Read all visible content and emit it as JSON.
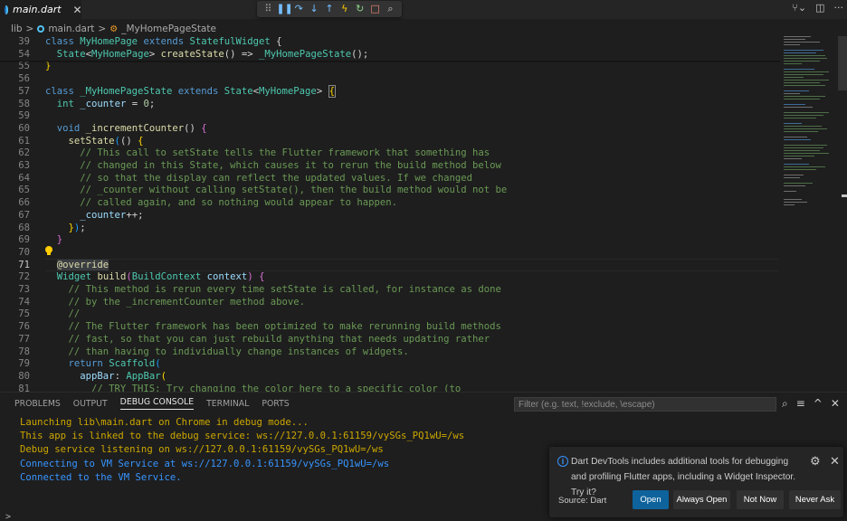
{
  "tab": {
    "title": "main.dart",
    "close_glyph": "✕"
  },
  "debug_toolbar": [
    {
      "name": "drag-handle-icon",
      "glyph": "⠿"
    },
    {
      "name": "pause-icon",
      "glyph": "❚❚"
    },
    {
      "name": "step-over-icon",
      "glyph": "↷"
    },
    {
      "name": "step-into-icon",
      "glyph": "↓"
    },
    {
      "name": "step-out-icon",
      "glyph": "↑"
    },
    {
      "name": "hot-reload-icon",
      "glyph": "ϟ"
    },
    {
      "name": "restart-icon",
      "glyph": "↻"
    },
    {
      "name": "stop-icon",
      "glyph": "□"
    },
    {
      "name": "widget-inspector-icon",
      "glyph": "⌕"
    }
  ],
  "title_actions": {
    "source_control": "⑂⌄",
    "split_editor": "◫",
    "more": "···"
  },
  "breadcrumb": {
    "folder": "lib",
    "file": "main.dart",
    "symbol": "_MyHomePageState",
    "sep": ">"
  },
  "editor": {
    "lines": [
      {
        "n": "39",
        "tokens": [
          [
            "class ",
            "kw"
          ],
          [
            "MyHomePage",
            "cls"
          ],
          [
            " extends ",
            "kw"
          ],
          [
            "StatefulWidget",
            "cls"
          ],
          [
            " {",
            ""
          ]
        ]
      },
      {
        "n": "54",
        "tokens": [
          [
            "  ",
            ""
          ],
          [
            "State",
            "cls"
          ],
          [
            "<",
            ""
          ],
          [
            "MyHomePage",
            "cls"
          ],
          [
            "> ",
            ""
          ],
          [
            "createState",
            "fn"
          ],
          [
            "() => ",
            ""
          ],
          [
            "_MyHomePageState",
            "cls"
          ],
          [
            "();",
            ""
          ]
        ]
      },
      {
        "n": "55",
        "tokens": [
          [
            "}",
            "b1"
          ]
        ]
      },
      {
        "n": "56",
        "tokens": []
      },
      {
        "n": "57",
        "tokens": [
          [
            "class ",
            "kw"
          ],
          [
            "_MyHomePageState",
            "cls"
          ],
          [
            " extends ",
            "kw"
          ],
          [
            "State",
            "cls"
          ],
          [
            "<",
            ""
          ],
          [
            "MyHomePage",
            "cls"
          ],
          [
            "> ",
            ""
          ],
          [
            "{",
            "b1"
          ]
        ]
      },
      {
        "n": "58",
        "tokens": [
          [
            "  ",
            ""
          ],
          [
            "int",
            "cls"
          ],
          [
            " ",
            ""
          ],
          [
            "_counter",
            "var"
          ],
          [
            " = ",
            ""
          ],
          [
            "0",
            "num"
          ],
          [
            ";",
            ""
          ]
        ]
      },
      {
        "n": "59",
        "tokens": []
      },
      {
        "n": "60",
        "tokens": [
          [
            "  ",
            ""
          ],
          [
            "void",
            "kw"
          ],
          [
            " ",
            ""
          ],
          [
            "_incrementCounter",
            "fn"
          ],
          [
            "() ",
            ""
          ],
          [
            "{",
            "b2"
          ]
        ]
      },
      {
        "n": "61",
        "tokens": [
          [
            "    ",
            ""
          ],
          [
            "setState",
            "fn"
          ],
          [
            "(",
            "b3"
          ],
          [
            "() ",
            ""
          ],
          [
            "{",
            "b1"
          ]
        ]
      },
      {
        "n": "62",
        "tokens": [
          [
            "      // This call to setState tells the Flutter framework that something has",
            "cmt"
          ]
        ]
      },
      {
        "n": "63",
        "tokens": [
          [
            "      // changed in this State, which causes it to rerun the build method below",
            "cmt"
          ]
        ]
      },
      {
        "n": "64",
        "tokens": [
          [
            "      // so that the display can reflect the updated values. If we changed",
            "cmt"
          ]
        ]
      },
      {
        "n": "65",
        "tokens": [
          [
            "      // _counter without calling setState(), then the build method would not be",
            "cmt"
          ]
        ]
      },
      {
        "n": "66",
        "tokens": [
          [
            "      // called again, and so nothing would appear to happen.",
            "cmt"
          ]
        ]
      },
      {
        "n": "67",
        "tokens": [
          [
            "      ",
            ""
          ],
          [
            "_counter",
            "var"
          ],
          [
            "++;",
            ""
          ]
        ]
      },
      {
        "n": "68",
        "tokens": [
          [
            "    ",
            ""
          ],
          [
            "}",
            "b1"
          ],
          [
            ")",
            "b3"
          ],
          [
            ";",
            ""
          ]
        ]
      },
      {
        "n": "69",
        "tokens": [
          [
            "  ",
            ""
          ],
          [
            "}",
            "b2"
          ]
        ]
      },
      {
        "n": "70",
        "tokens": []
      },
      {
        "n": "71",
        "tokens": [
          [
            "  ",
            ""
          ],
          [
            "@override",
            "ann"
          ]
        ],
        "active": true
      },
      {
        "n": "72",
        "tokens": [
          [
            "  ",
            ""
          ],
          [
            "Widget",
            "cls"
          ],
          [
            " ",
            ""
          ],
          [
            "build",
            "fn"
          ],
          [
            "(",
            "b2"
          ],
          [
            "BuildContext",
            "cls"
          ],
          [
            " ",
            ""
          ],
          [
            "context",
            "var"
          ],
          [
            ")",
            "b2"
          ],
          [
            " ",
            ""
          ],
          [
            "{",
            "b2"
          ]
        ]
      },
      {
        "n": "73",
        "tokens": [
          [
            "    // This method is rerun every time setState is called, for instance as done",
            "cmt"
          ]
        ]
      },
      {
        "n": "74",
        "tokens": [
          [
            "    // by the _incrementCounter method above.",
            "cmt"
          ]
        ]
      },
      {
        "n": "75",
        "tokens": [
          [
            "    //",
            "cmt"
          ]
        ]
      },
      {
        "n": "76",
        "tokens": [
          [
            "    // The Flutter framework has been optimized to make rerunning build methods",
            "cmt"
          ]
        ]
      },
      {
        "n": "77",
        "tokens": [
          [
            "    // fast, so that you can just rebuild anything that needs updating rather",
            "cmt"
          ]
        ]
      },
      {
        "n": "78",
        "tokens": [
          [
            "    // than having to individually change instances of widgets.",
            "cmt"
          ]
        ]
      },
      {
        "n": "79",
        "tokens": [
          [
            "    ",
            ""
          ],
          [
            "return",
            "kw"
          ],
          [
            " ",
            ""
          ],
          [
            "Scaffold",
            "cls"
          ],
          [
            "(",
            "b3"
          ]
        ]
      },
      {
        "n": "80",
        "tokens": [
          [
            "      ",
            ""
          ],
          [
            "appBar",
            "var"
          ],
          [
            ": ",
            ""
          ],
          [
            "AppBar",
            "cls"
          ],
          [
            "(",
            "b1"
          ]
        ]
      },
      {
        "n": "81",
        "tokens": [
          [
            "        // TRY THIS: Try changing the color here to a specific color (to",
            "cmt"
          ]
        ]
      }
    ]
  },
  "panel": {
    "tabs": [
      "PROBLEMS",
      "OUTPUT",
      "DEBUG CONSOLE",
      "TERMINAL",
      "PORTS"
    ],
    "active_tab": "DEBUG CONSOLE",
    "filter_placeholder": "Filter (e.g. text, !exclude, \\escape)",
    "actions": {
      "search": "⌕",
      "clear": "≡",
      "maximize": "^",
      "close": "✕"
    },
    "console": [
      {
        "text": "Launching lib\\main.dart on Chrome in debug mode...",
        "color": "#cca700"
      },
      {
        "text": "This app is linked to the debug service: ws://127.0.0.1:61159/vySGs_PQ1wU=/ws",
        "color": "#cca700"
      },
      {
        "text": "Debug service listening on ws://127.0.0.1:61159/vySGs_PQ1wU=/ws",
        "color": "#cca700"
      },
      {
        "text": "Connecting to VM Service at ws://127.0.0.1:61159/vySGs_PQ1wU=/ws",
        "color": "#3794ff"
      },
      {
        "text": "Connected to the VM Service.",
        "color": "#3794ff"
      }
    ],
    "caret": ">"
  },
  "notification": {
    "message": "Dart DevTools includes additional tools for debugging and profiling Flutter apps, including a Widget Inspector. Try it?",
    "source": "Source: Dart",
    "buttons": [
      "Open",
      "Always Open",
      "Not Now",
      "Never Ask"
    ],
    "gear": "⚙",
    "close": "✕",
    "info": "i"
  },
  "colors": {
    "editor_bg": "#1e1e1e",
    "accent": "#0e639c",
    "info": "#3794ff",
    "warning_text": "#cca700"
  }
}
